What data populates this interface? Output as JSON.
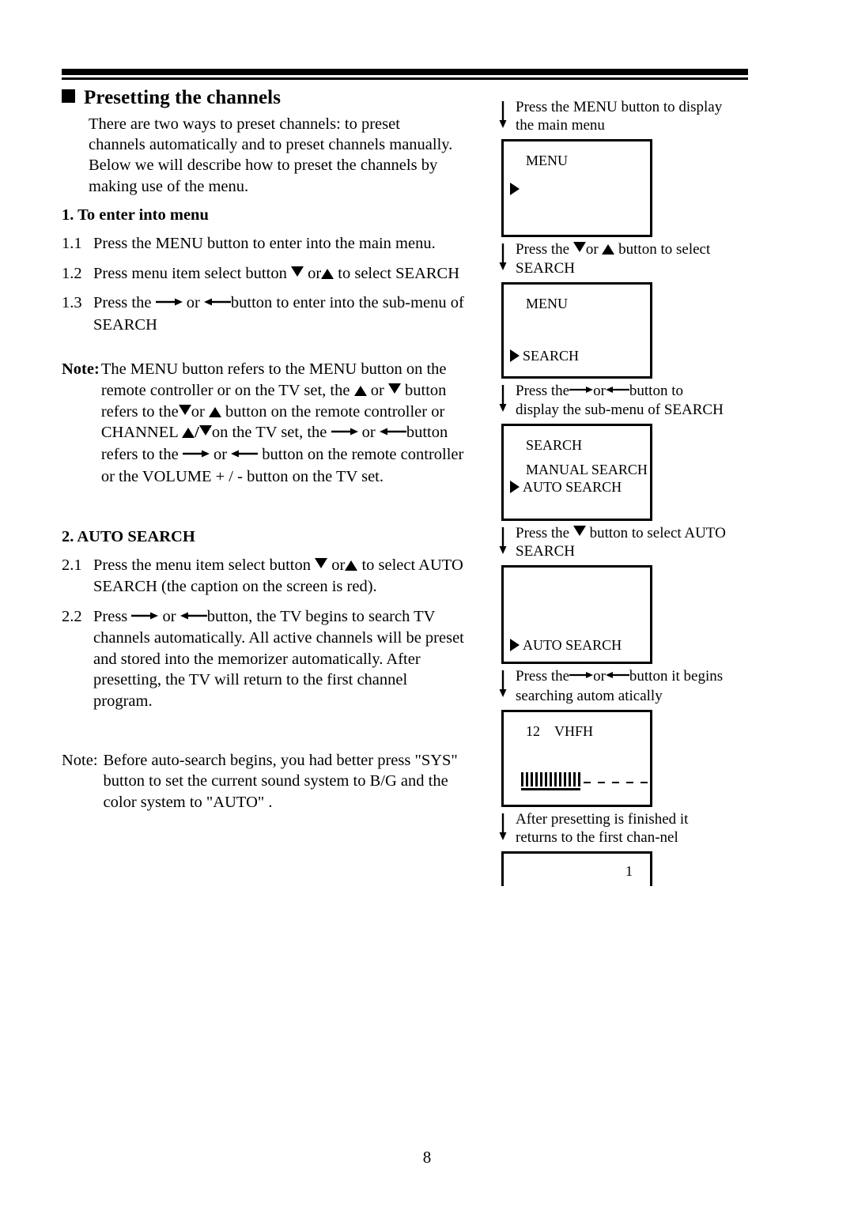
{
  "page": {
    "number": "8"
  },
  "section": {
    "bullet": "black-square",
    "title": "Presetting the channels",
    "intro": "There are two ways to preset channels: to preset channels automatically and to preset channels manually. Below we will describe how to preset the channels by making use of the menu."
  },
  "part1": {
    "heading": "1. To enter into menu",
    "steps": [
      {
        "number": "1.1",
        "text": "Press the MENU button to enter into the main menu."
      },
      {
        "number": "1.2",
        "text_before": "Press menu item select button",
        "icon1": "triangle-down-icon",
        "text_mid": "or",
        "icon2": "triangle-up-icon",
        "text_after": "to select SEARCH"
      },
      {
        "number": "1.3",
        "text_before": "Press the",
        "icon1": "arrow-right-icon",
        "text_mid": "or",
        "icon2": "arrow-left-icon",
        "text_after": "button to enter into the sub-menu of SEARCH"
      }
    ]
  },
  "note1": {
    "label": "Note:",
    "line1_a": "The MENU button refers to the MENU button on the remote controller or on the TV set, the",
    "icon_up_1": "triangle-up-icon",
    "line1_b": "or",
    "icon_down_1": "triangle-down-icon",
    "line1_c": "button refers to the",
    "icon_down_2": "triangle-down-icon",
    "line1_d": "or",
    "icon_up_2": "triangle-up-icon",
    "line1_e": "button on the remote controller or CHANNEL",
    "icon_up_3": "triangle-up-icon",
    "slash": "/",
    "icon_down_3": "triangle-down-icon",
    "line1_f": "on the TV set, the",
    "icon_right_1": "arrow-right-icon",
    "line1_g": "or",
    "icon_left_1": "arrow-left-icon",
    "line1_h": "button refers to the",
    "icon_right_2": "arrow-right-icon",
    "line1_i": "or",
    "icon_left_2": "arrow-left-icon",
    "line1_j": "button on the remote controller or the VOLUME + / - button on the TV set."
  },
  "part2": {
    "heading": "2. AUTO SEARCH",
    "steps": [
      {
        "number": "2.1",
        "text_before": "Press the menu item select button",
        "icon1": "triangle-down-icon",
        "text_mid": "or",
        "icon2": "triangle-up-icon",
        "text_after": "to select AUTO SEARCH (the caption on the screen is red)."
      },
      {
        "number": "2.2",
        "text_before": "Press",
        "icon1": "arrow-right-icon",
        "text_mid": "or",
        "icon2": "arrow-left-icon",
        "text_after": "button, the TV begins to search TV channels automatically. All active channels will be preset and stored into the memorizer automatically. After presetting, the TV will return to the first channel program."
      }
    ]
  },
  "note2": {
    "label": "Note:",
    "text": "Before auto-search begins, you had better press \"SYS\" button to set the current sound system to B/G and the color system to \"AUTO\" ."
  },
  "flow": {
    "steps": [
      {
        "arrow_icon": "arrow-down-icon",
        "caption": "Press the MENU button to display the main menu",
        "screen": {
          "title": "MENU",
          "pointer_icon": "pointer-triangle-icon",
          "pointer_label": ""
        }
      },
      {
        "arrow_icon": "arrow-down-icon",
        "caption_a": "Press the",
        "caption_icon1": "triangle-down-icon",
        "caption_b": "or",
        "caption_icon2": "triangle-up-icon",
        "caption_c": "button to select SEARCH",
        "screen": {
          "title": "MENU",
          "pointer_icon": "pointer-triangle-icon",
          "pointer_label": "SEARCH"
        }
      },
      {
        "arrow_icon": "arrow-down-icon",
        "caption_a": "Press the",
        "caption_icon1": "arrow-right-icon",
        "caption_b": "or",
        "caption_icon2": "arrow-left-icon",
        "caption_c": "button to display the sub-menu of SEARCH",
        "screen": {
          "title": "SEARCH",
          "item1": "MANUAL SEARCH",
          "pointer_icon": "pointer-triangle-icon",
          "pointer_label": "AUTO SEARCH"
        }
      },
      {
        "arrow_icon": "arrow-down-icon",
        "caption_a": "Press the",
        "caption_icon1": "triangle-down-icon",
        "caption_b": "button to select AUTO SEARCH",
        "screen": {
          "pointer_icon": "pointer-triangle-icon",
          "pointer_label": "AUTO SEARCH"
        }
      },
      {
        "arrow_icon": "arrow-down-icon",
        "caption_a": "Press the",
        "caption_icon1": "arrow-right-icon",
        "caption_b": "or",
        "caption_icon2": "arrow-left-icon",
        "caption_c": "button it begins searching autom atically",
        "screen": {
          "channel": "12",
          "band": "VHFH",
          "progress_bars": 13,
          "progress_dashes": 5
        }
      },
      {
        "arrow_icon": "arrow-down-icon",
        "caption": "After presetting is finished it returns  to the first chan-nel",
        "screen": {
          "channel_number": "1"
        }
      }
    ]
  }
}
